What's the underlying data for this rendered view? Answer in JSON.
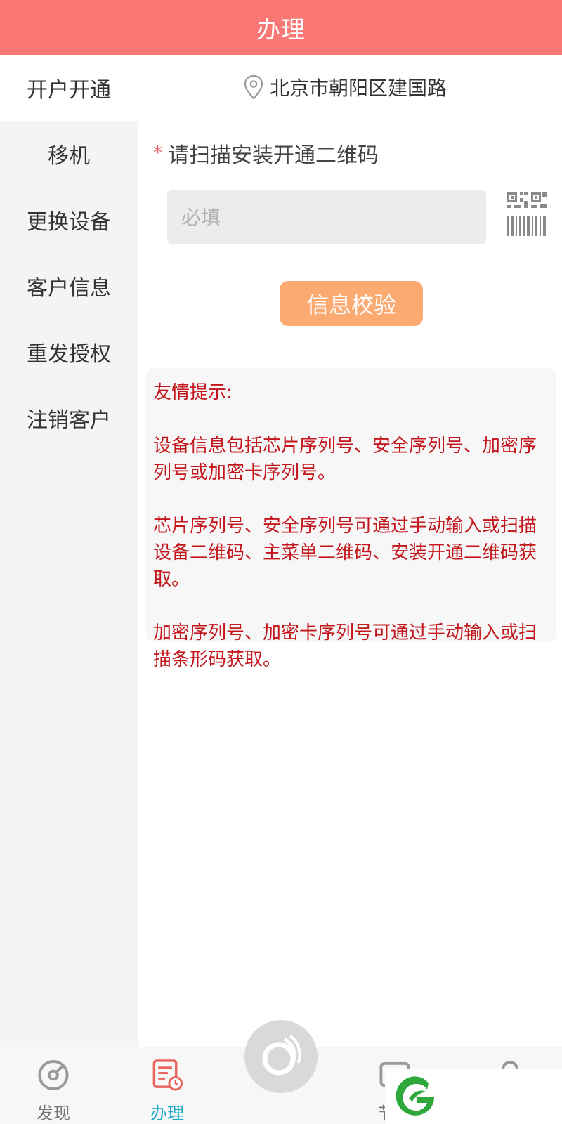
{
  "header": {
    "title": "办理"
  },
  "sidebar": {
    "items": [
      {
        "label": "开户开通",
        "active": true
      },
      {
        "label": "移机",
        "active": false
      },
      {
        "label": "更换设备",
        "active": false
      },
      {
        "label": "客户信息",
        "active": false
      },
      {
        "label": "重发授权",
        "active": false
      },
      {
        "label": "注销客户",
        "active": false
      }
    ]
  },
  "location": {
    "text": "北京市朝阳区建国路",
    "icon": "location-pin-icon"
  },
  "form": {
    "required_mark": "*",
    "scan_label": "请扫描安装开通二维码",
    "input_placeholder": "必填",
    "input_value": "",
    "scan_icon": "qrcode-barcode-scan-icon",
    "verify_button": "信息校验"
  },
  "tips": {
    "title": "友情提示:",
    "paragraphs": [
      "设备信息包括芯片序列号、安全序列号、加密序列号或加密卡序列号。",
      "芯片序列号、安全序列号可通过手动输入或扫描设备二维码、主菜单二维码、安装开通二维码获取。",
      "加密序列号、加密卡序列号可通过手动输入或扫描条形码获取。"
    ]
  },
  "tabbar": {
    "tabs": [
      {
        "label": "发现",
        "icon": "compass-icon",
        "active": false
      },
      {
        "label": "办理",
        "icon": "document-clock-icon",
        "active": true
      },
      {
        "label": "节目",
        "icon": "play-icon",
        "active": false
      },
      {
        "label": "",
        "icon": "user-icon",
        "active": false
      }
    ],
    "center_icon": "center-logo-icon"
  },
  "colors": {
    "header_bg": "#f97774",
    "verify_button_bg": "#fbaa72",
    "tips_text": "#c3161c",
    "active_tab": "#1ba8c8",
    "active_tab_icon": "#e8635c",
    "logo_green": "#2ea83b"
  }
}
